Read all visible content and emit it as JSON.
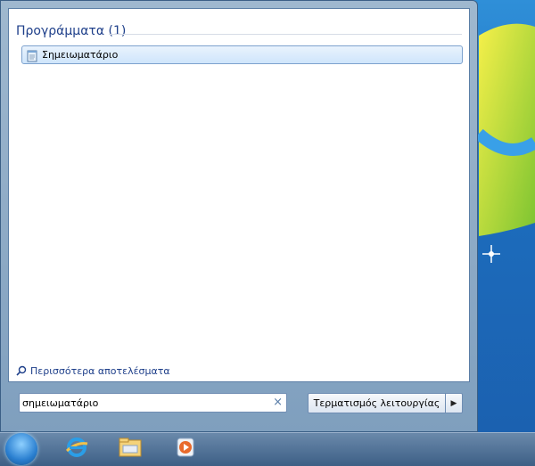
{
  "start_menu": {
    "section_title": "Προγράμματα (1)",
    "results": [
      {
        "label": "Σημειωματάριο",
        "icon": "notepad-icon"
      }
    ],
    "more_results": "Περισσότερα αποτελέσματα",
    "search": {
      "value": "σημειωματάριο",
      "clear_icon": "clear-icon"
    },
    "shutdown_label": "Τερματισμός λειτουργίας"
  },
  "taskbar": {
    "items": [
      {
        "name": "internet-explorer",
        "icon": "internet-explorer-icon"
      },
      {
        "name": "file-explorer",
        "icon": "folder-icon"
      },
      {
        "name": "media-player",
        "icon": "media-player-icon"
      }
    ]
  },
  "colors": {
    "accent": "#1e3f8a",
    "highlight": "#cfe5fb",
    "taskbar": "#3d5f85"
  }
}
